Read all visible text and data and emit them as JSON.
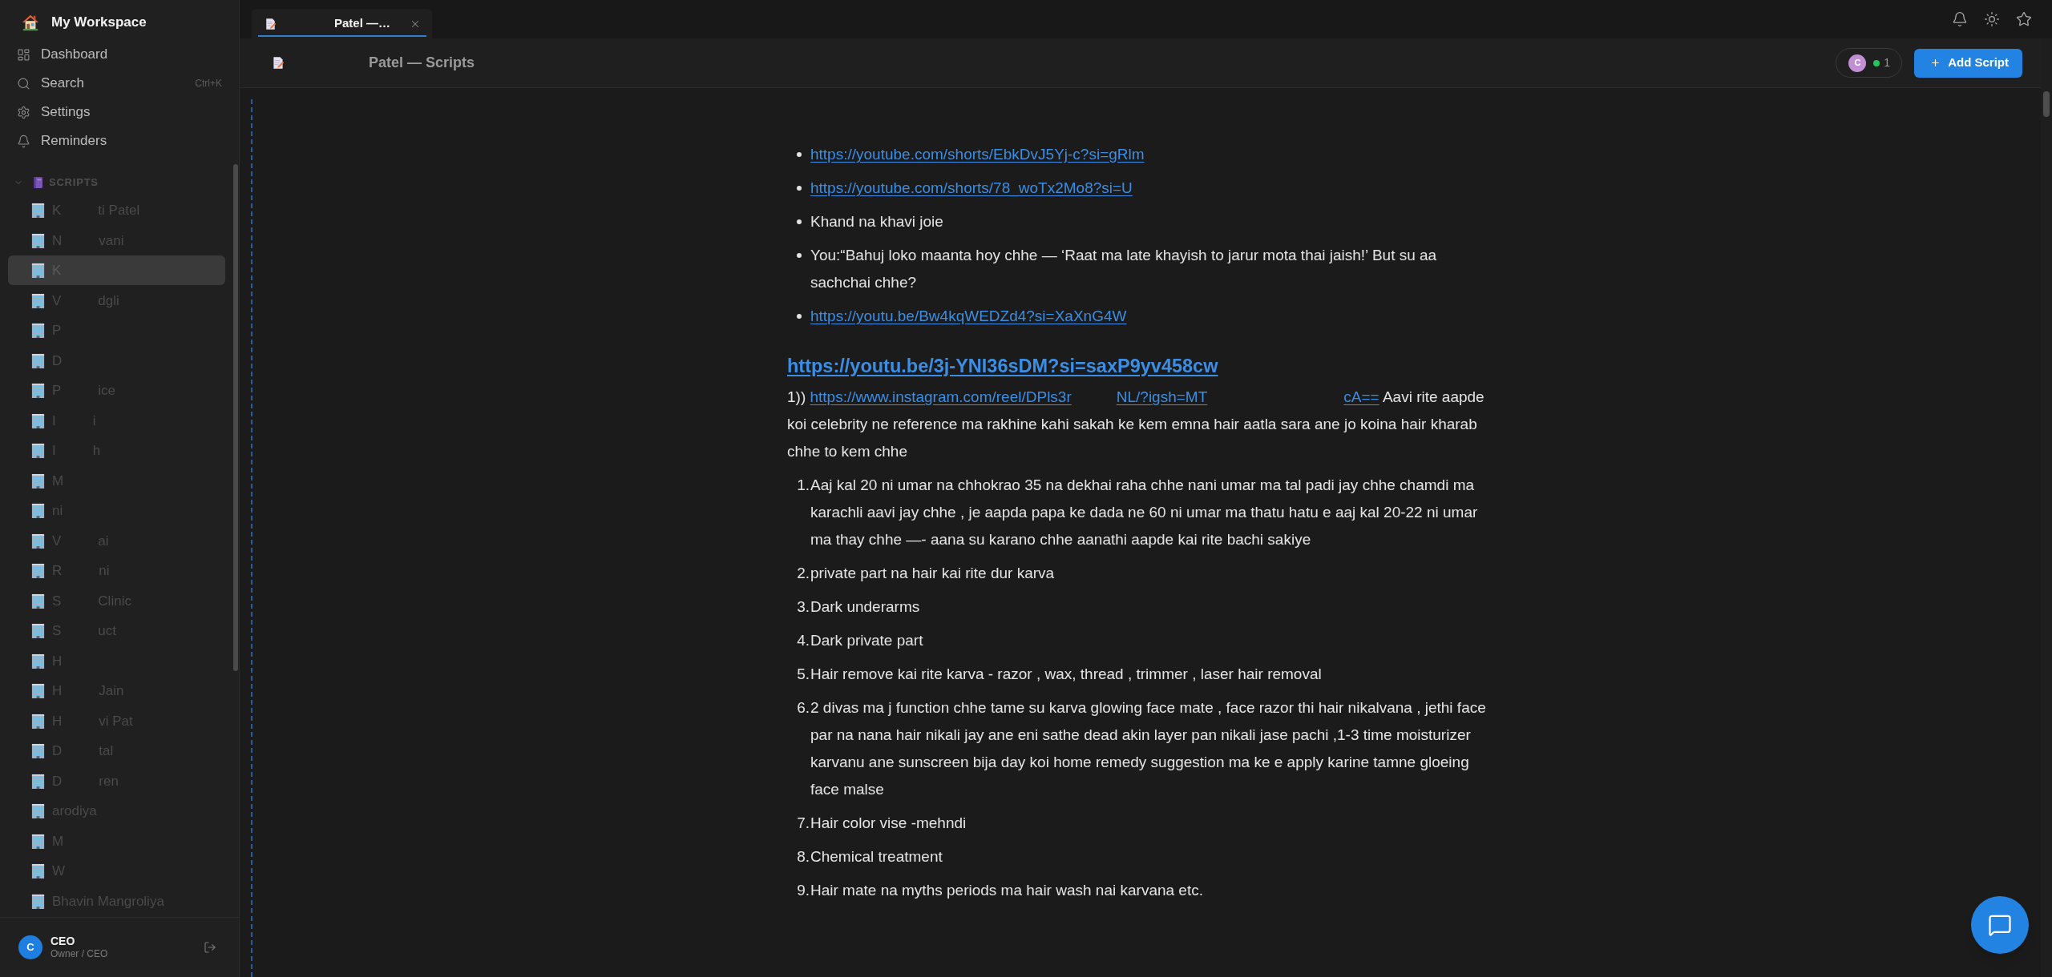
{
  "sidebar": {
    "workspace": "My Workspace",
    "nav": [
      {
        "kind": "dashboard",
        "label": "Dashboard"
      },
      {
        "kind": "search",
        "label": "Search",
        "shortcut": "Ctrl+K"
      },
      {
        "kind": "settings",
        "label": "Settings"
      },
      {
        "kind": "reminders",
        "label": "Reminders"
      }
    ],
    "section": {
      "title": "SCRIPTS",
      "expanded": true,
      "items": [
        {
          "parts": [
            "K",
            "ti Patel"
          ],
          "selected": false
        },
        {
          "parts": [
            "N",
            "vani"
          ],
          "selected": false
        },
        {
          "parts": [
            "K"
          ],
          "selected": true
        },
        {
          "parts": [
            "V",
            "dgli"
          ],
          "selected": false
        },
        {
          "parts": [
            "P"
          ],
          "selected": false
        },
        {
          "parts": [
            "D"
          ],
          "selected": false
        },
        {
          "parts": [
            "P",
            "ice"
          ],
          "selected": false
        },
        {
          "parts": [
            "I",
            "i"
          ],
          "selected": false
        },
        {
          "parts": [
            "I",
            "h"
          ],
          "selected": false
        },
        {
          "parts": [
            "M"
          ],
          "selected": false
        },
        {
          "parts": [
            "ni"
          ],
          "selected": false
        },
        {
          "parts": [
            "V",
            "ai"
          ],
          "selected": false
        },
        {
          "parts": [
            "R",
            "ni"
          ],
          "selected": false
        },
        {
          "parts": [
            "S",
            "Clinic"
          ],
          "selected": false
        },
        {
          "parts": [
            "S",
            "uct"
          ],
          "selected": false
        },
        {
          "parts": [
            "H"
          ],
          "selected": false
        },
        {
          "parts": [
            "H",
            "Jain"
          ],
          "selected": false
        },
        {
          "parts": [
            "H",
            "vi Pat"
          ],
          "selected": false
        },
        {
          "parts": [
            "D",
            "tal"
          ],
          "selected": false
        },
        {
          "parts": [
            "D",
            "ren"
          ],
          "selected": false
        },
        {
          "parts": [
            "arodiya"
          ],
          "selected": false
        },
        {
          "parts": [
            "M"
          ],
          "selected": false
        },
        {
          "parts": [
            "W"
          ],
          "selected": false
        },
        {
          "parts": [
            "Bhavin Mangroliya"
          ],
          "selected": false
        }
      ]
    },
    "user": {
      "initial": "C",
      "name": "CEO",
      "role": "Owner / CEO"
    }
  },
  "tabs": [
    {
      "label": "Patel —…",
      "selected": true
    }
  ],
  "header": {
    "title": "Patel — Scripts",
    "presence": {
      "initial": "C",
      "count": "1"
    },
    "add_button": "Add Script"
  },
  "document": [
    {
      "kind": "bullet_list",
      "items": [
        {
          "kind": "link",
          "parts": [
            "https://youtube.com/shorts/EbkDvJ5Yj-c?si=gRlm"
          ]
        },
        {
          "kind": "link",
          "parts": [
            "https://youtube.com/shorts/78_woTx2Mo8?si=U"
          ]
        },
        {
          "kind": "text",
          "text": "Khand na khavi joie"
        },
        {
          "kind": "text",
          "text": "You:“Bahuj loko maanta hoy chhe — ‘Raat ma late khayish to jarur mota thai jaish!’ But su aa sachchai chhe?"
        },
        {
          "kind": "link",
          "parts": [
            "https://youtu.be/Bw4kqWEDZd4?si=XaXnG4W"
          ]
        }
      ]
    },
    {
      "kind": "heading",
      "segments": [
        {
          "kind": "link",
          "parts": [
            "https://youtu.be/3j-YNI36sDM?si=saxP9yv458cw"
          ]
        }
      ]
    },
    {
      "kind": "paragraph",
      "segments": [
        {
          "kind": "text",
          "text": "1)) "
        },
        {
          "kind": "link",
          "parts": [
            "https://www.instagram.com/reel/DPls3r",
            "NL/?igsh=MT",
            "cA=="
          ]
        },
        {
          "kind": "text",
          "text": " Aavi rite aapde koi celebrity ne reference ma rakhine kahi sakah ke kem emna hair aatla sara ane jo koina hair kharab chhe to kem chhe"
        }
      ]
    },
    {
      "kind": "numbered_list",
      "items": [
        {
          "marker": "1.",
          "text": "Aaj kal 20 ni umar na chhokrao 35 na dekhai raha chhe nani umar ma tal padi jay chhe chamdi ma karachli aavi jay chhe , je aapda papa ke dada ne 60 ni umar ma thatu hatu e aaj kal 20-22 ni umar ma thay chhe —- aana su karano chhe aanathi aapde kai rite bachi sakiye"
        },
        {
          "marker": "2.",
          "text": "private part na hair kai rite dur karva"
        },
        {
          "marker": "3.",
          "text": "Dark underarms"
        },
        {
          "marker": "4.",
          "text": "Dark private part"
        },
        {
          "marker": "5.",
          "text": "Hair remove kai rite karva - razor , wax, thread , trimmer , laser hair removal"
        },
        {
          "marker": "6.",
          "text": "2 divas ma j function chhe tame su karva glowing face mate , face razor thi hair nikalvana , jethi face par na nana hair nikali jay ane eni sathe dead akin layer pan nikali jase pachi ,1-3 time moisturizer karvanu ane sunscreen bija day koi home remedy suggestion ma ke e apply karine tamne gloeing face malse"
        },
        {
          "marker": "7.",
          "text": "Hair color vise -mehndi"
        },
        {
          "marker": "8.",
          "text": "Chemical treatment"
        },
        {
          "marker": "9.",
          "text": "Hair mate na myths periods ma hair wash nai karvana etc."
        }
      ]
    }
  ]
}
